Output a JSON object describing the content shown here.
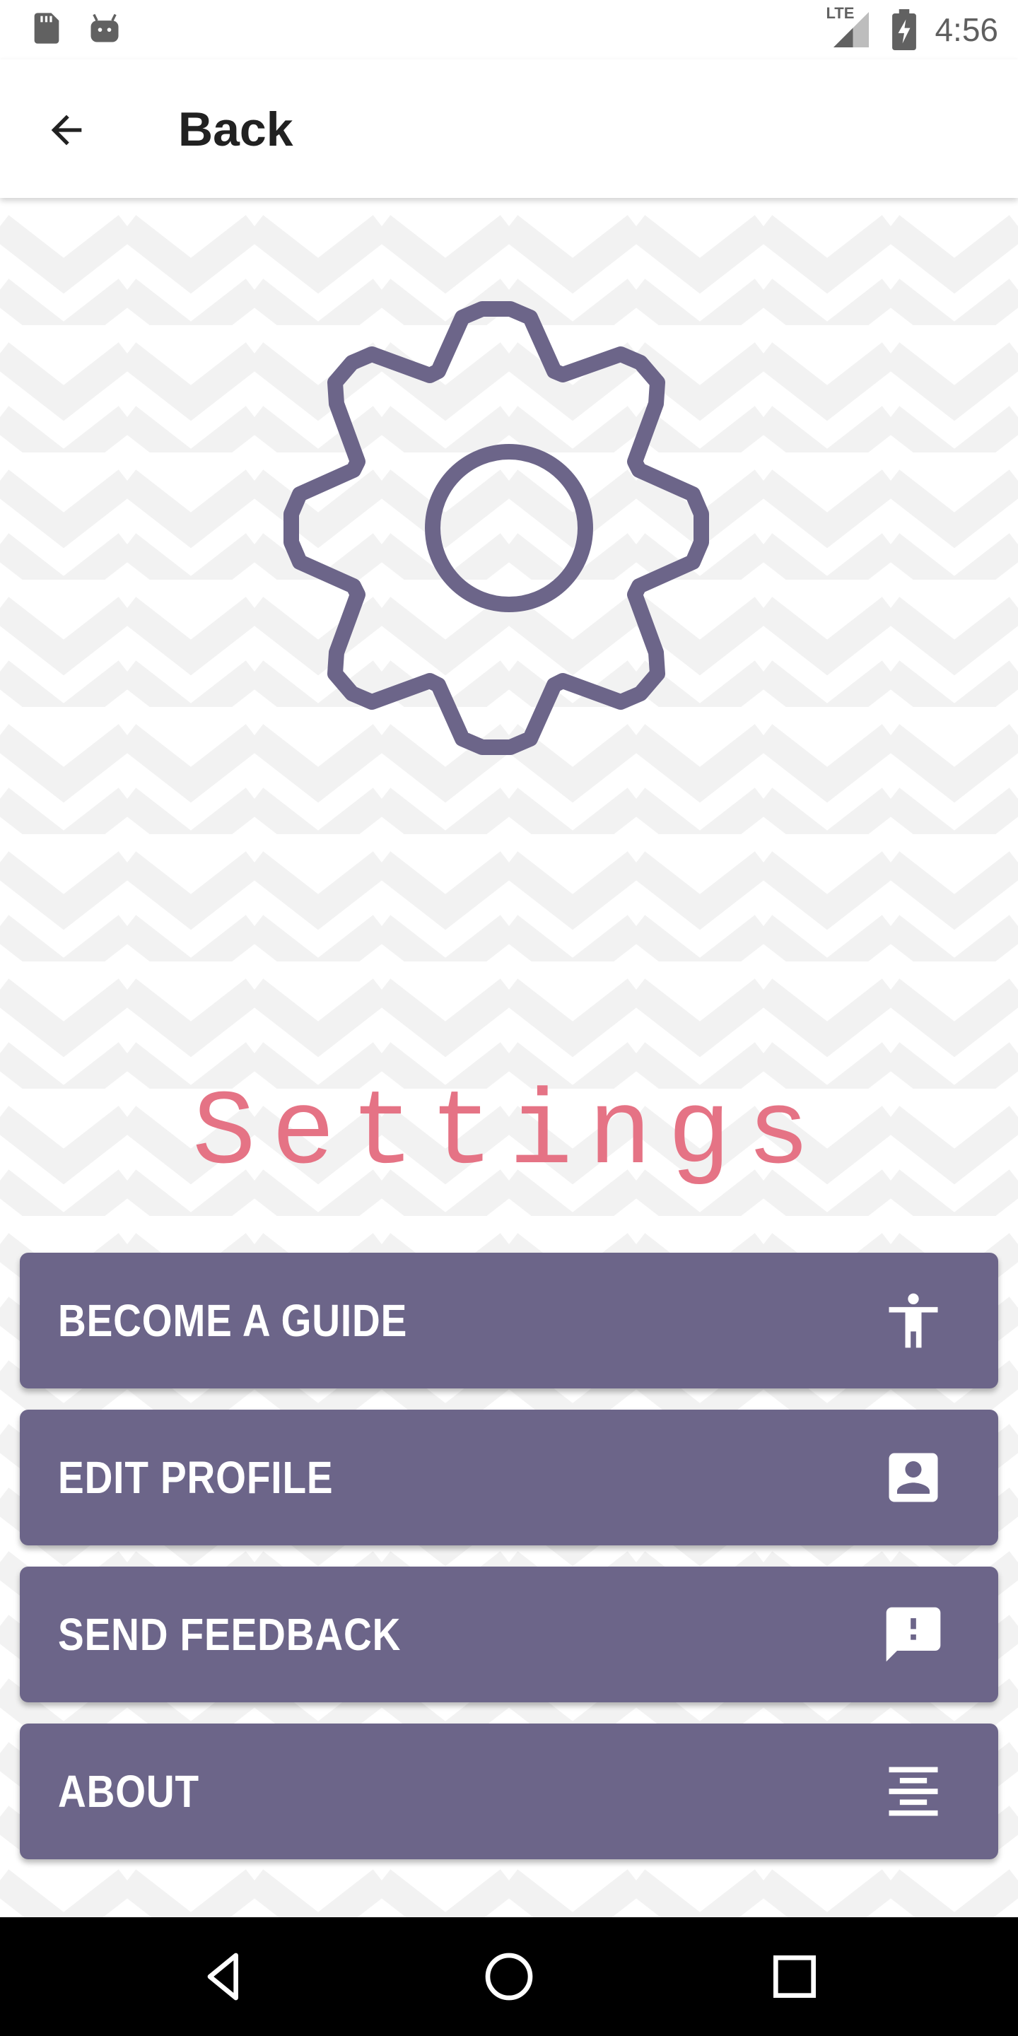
{
  "status_bar": {
    "time": "4:56",
    "network": "LTE",
    "left_icons": [
      "sd-card-icon",
      "android-icon"
    ],
    "right_icons": [
      "signal-icon",
      "battery-charging-icon"
    ]
  },
  "app_bar": {
    "back_label": "Back",
    "back_icon": "arrow-left-icon"
  },
  "page": {
    "title": "Settings",
    "hero_icon": "gear-icon"
  },
  "menu": [
    {
      "label": "BECOME A GUIDE",
      "icon": "accessibility-icon"
    },
    {
      "label": "EDIT PROFILE",
      "icon": "contact-card-icon"
    },
    {
      "label": "SEND FEEDBACK",
      "icon": "feedback-icon"
    },
    {
      "label": "ABOUT",
      "icon": "align-center-icon"
    }
  ],
  "nav_bar": {
    "buttons": [
      "back-triangle-icon",
      "home-circle-icon",
      "recents-square-icon"
    ]
  },
  "colors": {
    "accent_purple": "#6c6589",
    "title_pink": "#e57385",
    "text_dark": "#212121",
    "nav_bg": "#000000"
  }
}
